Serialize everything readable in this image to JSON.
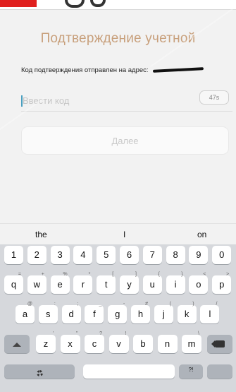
{
  "header": {
    "accent_color": "#e0201e"
  },
  "screen": {
    "title": "Подтверждение учетной",
    "sent_text": "Код подтверждения отправлен на адрес:",
    "code_input": {
      "placeholder": "Ввести код",
      "value": ""
    },
    "timer": "47s",
    "next_label": "Далее"
  },
  "keyboard": {
    "suggestions": [
      "the",
      "I",
      "on"
    ],
    "numbers": [
      "1",
      "2",
      "3",
      "4",
      "5",
      "6",
      "7",
      "8",
      "9",
      "0"
    ],
    "row1": [
      {
        "k": "q",
        "h": "="
      },
      {
        "k": "w",
        "h": "+"
      },
      {
        "k": "e",
        "h": "%"
      },
      {
        "k": "r",
        "h": "*"
      },
      {
        "k": "t",
        "h": "["
      },
      {
        "k": "y",
        "h": "]"
      },
      {
        "k": "u",
        "h": "{"
      },
      {
        "k": "i",
        "h": "}"
      },
      {
        "k": "o",
        "h": "<"
      },
      {
        "k": "p",
        "h": ">"
      }
    ],
    "row2": [
      {
        "k": "a",
        "h": "@"
      },
      {
        "k": "s",
        "h": ":"
      },
      {
        "k": "d",
        "h": ";"
      },
      {
        "k": "f",
        "h": "_"
      },
      {
        "k": "g",
        "h": "-"
      },
      {
        "k": "h",
        "h": "#"
      },
      {
        "k": "j",
        "h": "("
      },
      {
        "k": "k",
        "h": ")"
      },
      {
        "k": "l",
        "h": "/"
      }
    ],
    "row3": [
      {
        "k": "z",
        "h": "'"
      },
      {
        "k": "x",
        "h": "\""
      },
      {
        "k": "c",
        "h": "?"
      },
      {
        "k": "v",
        "h": "!"
      },
      {
        "k": "b",
        "h": ""
      },
      {
        "k": "n",
        "h": ""
      },
      {
        "k": "m",
        "h": "\\"
      }
    ],
    "sym_hint": "?!"
  }
}
